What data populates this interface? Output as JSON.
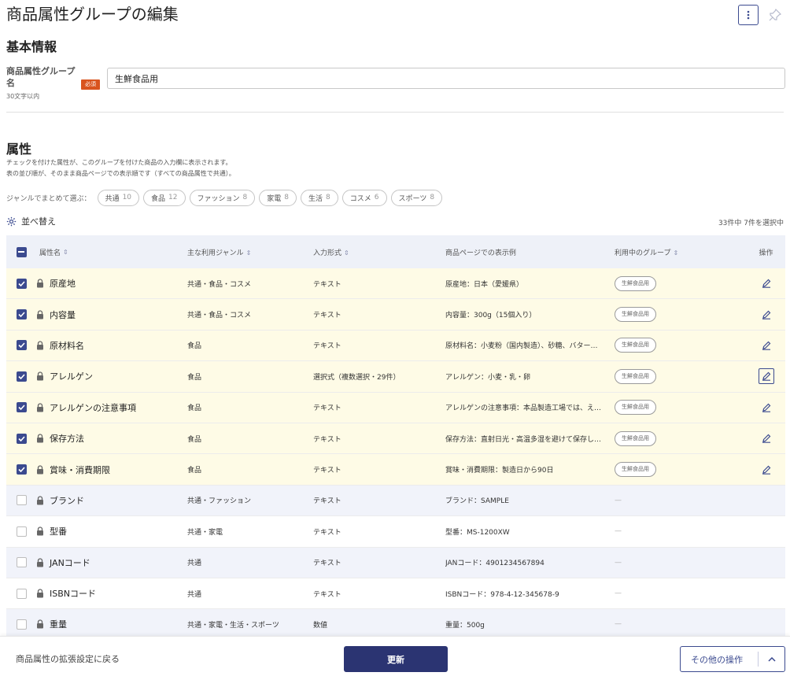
{
  "page": {
    "title": "商品属性グループの編集"
  },
  "basic": {
    "section_title": "基本情報",
    "name_label": "商品属性グループ名",
    "name_hint": "30文字以内",
    "required_label": "必須",
    "name_value": "生鮮食品用"
  },
  "attributes": {
    "section_title": "属性",
    "desc_line1": "チェックを付けた属性が、このグループを付けた商品の入力欄に表示されます。",
    "desc_line2": "表の並び順が、そのまま商品ページでの表示順です（すべての商品属性で共通）。",
    "genre_label": "ジャンルでまとめて選ぶ：",
    "genres": [
      {
        "label": "共通",
        "count": "10"
      },
      {
        "label": "食品",
        "count": "12"
      },
      {
        "label": "ファッション",
        "count": "8"
      },
      {
        "label": "家電",
        "count": "8"
      },
      {
        "label": "生活",
        "count": "8"
      },
      {
        "label": "コスメ",
        "count": "6"
      },
      {
        "label": "スポーツ",
        "count": "8"
      }
    ],
    "sort_label": "並べ替え",
    "count_text": "33件中 7件を選択中"
  },
  "table": {
    "headers": {
      "name": "属性名",
      "genre": "主な利用ジャンル",
      "input": "入力形式",
      "example": "商品ページでの表示例",
      "group": "利用中のグループ",
      "op": "操作"
    },
    "rows": [
      {
        "checked": true,
        "name": "原産地",
        "genre": "共通・食品・コスメ",
        "input": "テキスト",
        "example": "原産地：日本（愛媛県）",
        "group": "生鮮食品用"
      },
      {
        "checked": true,
        "name": "内容量",
        "genre": "共通・食品・コスメ",
        "input": "テキスト",
        "example": "内容量：300g（15個入り）",
        "group": "生鮮食品用"
      },
      {
        "checked": true,
        "name": "原材料名",
        "genre": "食品",
        "input": "テキスト",
        "example": "原材料名：小麦粉（国内製造）、砂糖、バター…",
        "group": "生鮮食品用"
      },
      {
        "checked": true,
        "name": "アレルゲン",
        "genre": "食品",
        "input": "選択式（複数選択・29件）",
        "example": "アレルゲン：小麦・乳・卵",
        "group": "生鮮食品用"
      },
      {
        "checked": true,
        "name": "アレルゲンの注意事項",
        "genre": "食品",
        "input": "テキスト",
        "example": "アレルゲンの注意事項：本品製造工場では、え…",
        "group": "生鮮食品用"
      },
      {
        "checked": true,
        "name": "保存方法",
        "genre": "食品",
        "input": "テキスト",
        "example": "保存方法：直射日光・高温多湿を避けて保存し…",
        "group": "生鮮食品用"
      },
      {
        "checked": true,
        "name": "賞味・消費期限",
        "genre": "食品",
        "input": "テキスト",
        "example": "賞味・消費期限：製造日から90日",
        "group": "生鮮食品用"
      },
      {
        "checked": false,
        "name": "ブランド",
        "genre": "共通・ファッション",
        "input": "テキスト",
        "example": "ブランド：SAMPLE",
        "group": "—"
      },
      {
        "checked": false,
        "name": "型番",
        "genre": "共通・家電",
        "input": "テキスト",
        "example": "型番：MS-1200XW",
        "group": "—"
      },
      {
        "checked": false,
        "name": "JANコード",
        "genre": "共通",
        "input": "テキスト",
        "example": "JANコード：4901234567894",
        "group": "—"
      },
      {
        "checked": false,
        "name": "ISBNコード",
        "genre": "共通",
        "input": "テキスト",
        "example": "ISBNコード：978-4-12-345678-9",
        "group": "—"
      },
      {
        "checked": false,
        "name": "重量",
        "genre": "共通・家電・生活・スポーツ",
        "input": "数値",
        "example": "重量：500g",
        "group": "—"
      }
    ]
  },
  "footer": {
    "back_label": "商品属性の拡張設定に戻る",
    "update_label": "更新",
    "other_label": "その他の操作"
  },
  "colors": {
    "accent": "#3b4a8f",
    "primary_button": "#2b3472",
    "required": "#d9541e",
    "selected_row": "#fefbe6"
  }
}
